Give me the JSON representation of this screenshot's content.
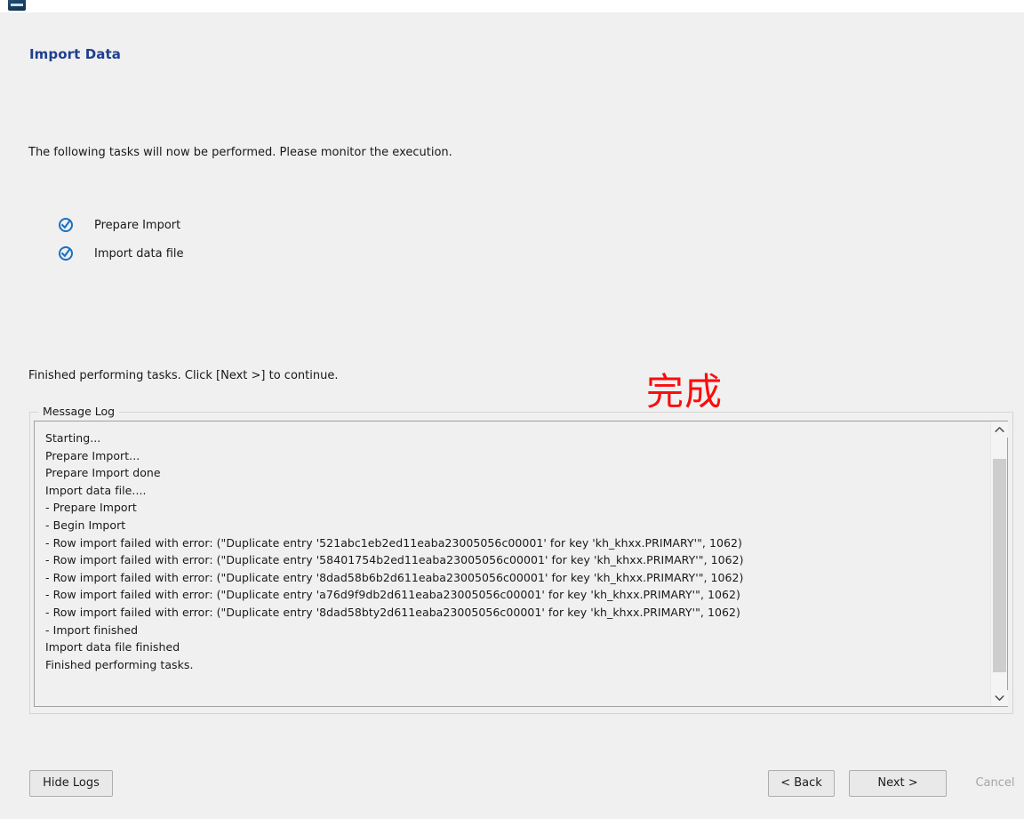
{
  "window": {
    "icon": "app-icon",
    "title": ""
  },
  "page": {
    "title": "Import Data",
    "intro": "The following tasks will now be performed. Please monitor the execution.",
    "status": "Finished performing tasks. Click [Next >] to continue."
  },
  "tasks": [
    {
      "label": "Prepare Import",
      "state": "done",
      "icon": "check-circle-icon"
    },
    {
      "label": "Import data file",
      "state": "done",
      "icon": "check-circle-icon"
    }
  ],
  "annotation": {
    "text": "完成",
    "color": "#fb0d0d"
  },
  "message_log": {
    "legend": "Message Log",
    "lines": [
      "Starting...",
      "Prepare Import...",
      "Prepare Import done",
      "Import data file....",
      "- Prepare Import",
      "- Begin Import",
      "- Row import failed with error: (\"Duplicate entry '521abc1eb2ed11eaba23005056c00001' for key 'kh_khxx.PRIMARY'\", 1062)",
      "- Row import failed with error: (\"Duplicate entry '58401754b2ed11eaba23005056c00001' for key 'kh_khxx.PRIMARY'\", 1062)",
      "- Row import failed with error: (\"Duplicate entry '8dad58b6b2d611eaba23005056c00001' for key 'kh_khxx.PRIMARY'\", 1062)",
      "- Row import failed with error: (\"Duplicate entry 'a76d9f9db2d611eaba23005056c00001' for key 'kh_khxx.PRIMARY'\", 1062)",
      "- Row import failed with error: (\"Duplicate entry '8dad58bty2d611eaba23005056c00001' for key 'kh_khxx.PRIMARY'\", 1062)",
      "- Import finished",
      "Import data file finished",
      "Finished performing tasks."
    ],
    "scrollbar": {
      "up_icon": "chevron-up-icon",
      "down_icon": "chevron-down-icon"
    }
  },
  "footer": {
    "hide_logs": "Hide Logs",
    "back": "< Back",
    "next": "Next >",
    "cancel": "Cancel",
    "cancel_enabled": false
  },
  "colors": {
    "title": "#1f3f8f",
    "background": "#f0f0f0",
    "check": "#1d6fc0",
    "annotation": "#fb0d0d"
  }
}
